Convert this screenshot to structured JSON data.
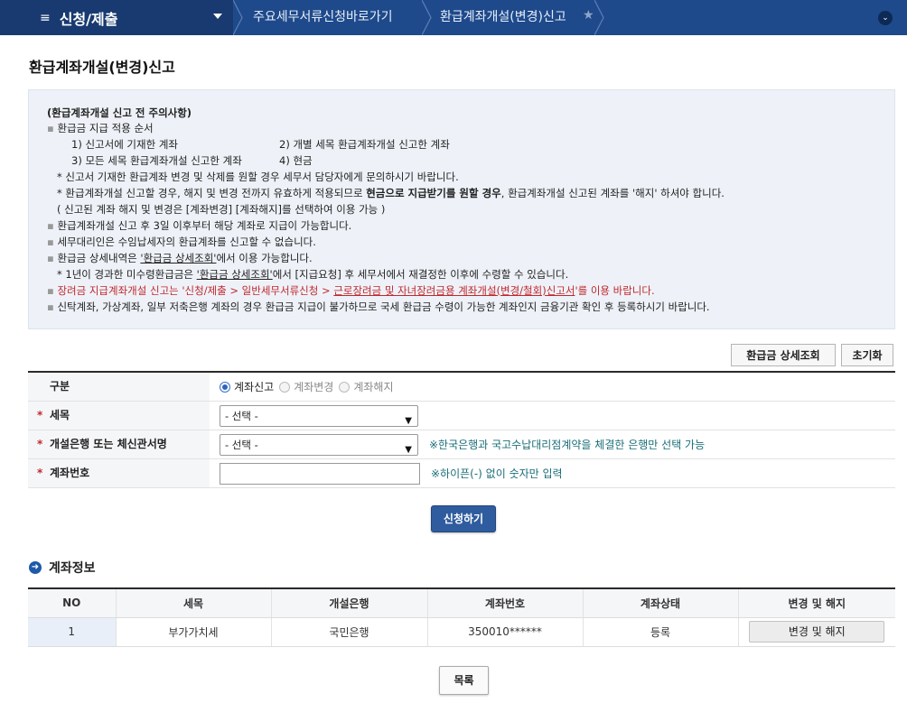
{
  "topbar": {
    "menu_icon": "≡",
    "menu_title": "신청/제출",
    "crumb1": "주요세무서류신청바로가기",
    "crumb2": "환급계좌개설(변경)신고",
    "star_icon": "★",
    "circle_icon": "⌄"
  },
  "page_title": "환급계좌개설(변경)신고",
  "notice": {
    "title": "(환급계좌개설 신고 전 주의사항)",
    "l1": "환급금 지급 적용 순서",
    "o1": "1) 신고서에 기재한 계좌",
    "o2": "2) 개별 세목 환급계좌개설 신고한 계좌",
    "o3": "3) 모든 세목 환급계좌개설 신고한 계좌",
    "o4": "4) 현금",
    "n1": "* 신고서 기재한 환급계좌 변경 및 삭제를 원할 경우 세무서 담당자에게 문의하시기 바랍니다.",
    "n2a": "* 환급계좌개설 신고할 경우, 해지 및 변경 전까지 유효하게 적용되므로 ",
    "n2b": "현금으로 지급받기를 원할 경우",
    "n2c": ", 환급계좌개설 신고된 계좌를 '해지' 하셔야 합니다.",
    "n3": "( 신고된 계좌 해지 및 변경은 [계좌변경] [계좌해지]를 선택하여 이용 가능 )",
    "l2": "환급계좌개설 신고 후 3일 이후부터 해당 계좌로 지급이 가능합니다.",
    "l3": "세무대리인은 수임납세자의 환급계좌를 신고할 수 없습니다.",
    "l4a": "환급금 상세내역은 ",
    "l4b": "'환급금 상세조회'",
    "l4c": "에서 이용 가능합니다.",
    "l5a": "* 1년이 경과한 미수령환급금은 ",
    "l5b": "'환급금 상세조회'",
    "l5c": "에서 [지급요청] 후 세무서에서 재결정한 이후에 수령할 수 있습니다.",
    "l6a": "장려금 지급계좌개설 신고는 '신청/제출 > 일반세무서류신청 > ",
    "l6b": "근로장려금 및 자녀장려금용 계좌개설(변경/철회)신고서",
    "l6c": "'를 이용 바랍니다.",
    "l7": "신탁계좌, 가상계좌, 일부 저축은행 계좌의 경우 환급금 지급이 불가하므로 국세 환급금 수령이 가능한 계좌인지 금융기관 확인 후 등록하시기 바랍니다."
  },
  "buttons": {
    "refund_detail": "환급금 상세조회",
    "reset": "초기화",
    "submit": "신청하기",
    "list": "목록"
  },
  "form": {
    "required_mark": "*",
    "type_label": "구분",
    "radio1": "계좌신고",
    "radio2": "계좌변경",
    "radio3": "계좌해지",
    "tax_label": "세목",
    "tax_value": "- 선택 -",
    "bank_label": "개설은행 또는 체신관서명",
    "bank_value": "- 선택 -",
    "bank_hint": "※한국은행과 국고수납대리점계약을 체결한 은행만 선택 가능",
    "acct_label": "계좌번호",
    "acct_value": "",
    "acct_hint": "※하이픈(-) 없이 숫자만 입력",
    "select_arrow": "▼"
  },
  "account_section": {
    "title": "계좌정보",
    "icon": "➜",
    "headers": [
      "NO",
      "세목",
      "개설은행",
      "계좌번호",
      "계좌상태",
      "변경 및 해지"
    ],
    "rows": [
      {
        "no": "1",
        "tax": "부가가치세",
        "bank": "국민은행",
        "acct": "350010******",
        "status": "등록",
        "action": "변경 및 해지"
      }
    ]
  }
}
